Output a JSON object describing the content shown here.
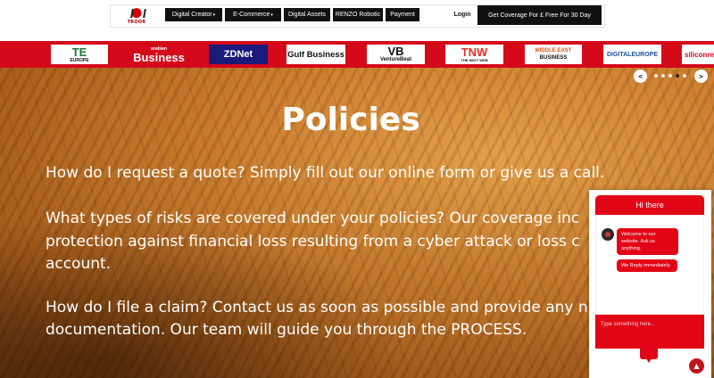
{
  "header": {
    "logo_text": "TROOR",
    "menu": [
      {
        "label": "Digital Creator",
        "has_dropdown": true
      },
      {
        "label": "E-Commerce",
        "has_dropdown": true
      },
      {
        "label": "Digital Assets",
        "has_dropdown": false
      },
      {
        "label": "RENZO Robotic",
        "has_dropdown": false
      },
      {
        "label": "Payment",
        "has_dropdown": false
      }
    ],
    "login_label": "Login",
    "cta_label": "Get Coverage For £ Free For 30 Day",
    "dropdown_icon": "chevron-down-icon"
  },
  "press_logos": [
    {
      "name": "TE Europe",
      "text": "TE",
      "sub": "EUROPE",
      "color": "#1b7a2f"
    },
    {
      "name": "Arabian Business",
      "text": "Business",
      "sub": "arabian",
      "color": "#d40a1a"
    },
    {
      "name": "ZDNet",
      "text": "ZDNet",
      "sub": "",
      "color": "#1a1a7a"
    },
    {
      "name": "Gulf Business",
      "text": "Gulf Business",
      "sub": "",
      "color": "#111111"
    },
    {
      "name": "VentureBeat",
      "text": "VB",
      "sub": "VentureBeat",
      "color": "#111111"
    },
    {
      "name": "TNW",
      "text": "TNW",
      "sub": "THE NEXT WEB",
      "color": "#e5302a"
    },
    {
      "name": "Middle East Business",
      "text": "MIDDLE EAST",
      "sub": "BUSINESS",
      "color": "#d4541a"
    },
    {
      "name": "DigitalEurope",
      "text": "DIGITALEUROPE",
      "sub": "",
      "color": "#1e4ea0"
    },
    {
      "name": "SiliconRepublic",
      "text": "siliconre",
      "sub": "",
      "color": "#d40a1a"
    }
  ],
  "carousel": {
    "prev": "<",
    "next": ">",
    "dots": 5,
    "active_dot": 4
  },
  "main": {
    "title": "Policies",
    "faq_lines": [
      "How do I request a quote? Simply fill out our online form or give us a call.",
      "What types of risks are covered under your policies? Our coverage inc",
      "protection against financial loss resulting from a cyber attack or loss c",
      "account.",
      "How do I file a claim? Contact us as soon as possible and provide any n",
      "documentation. Our team will guide you through the PROCESS."
    ]
  },
  "chat": {
    "header": "Hi there",
    "bot_message": "Welcome to our website. Ask us anything.",
    "bot_reply": "We Reply immediately.",
    "input_placeholder": "Type something here..",
    "send_icon": "message-icon",
    "accent_color": "#e10515"
  },
  "scroll_top_icon": "arrow-up-icon"
}
